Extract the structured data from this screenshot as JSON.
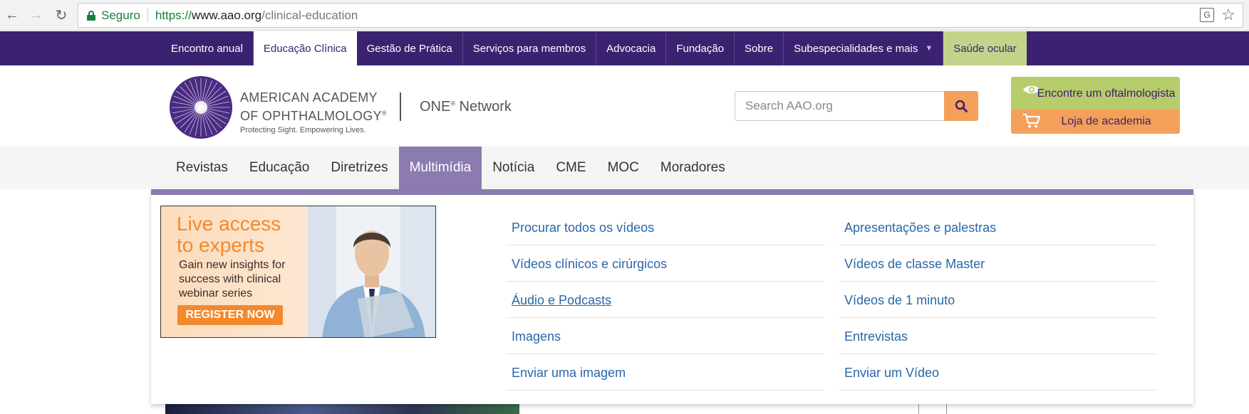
{
  "browser": {
    "secure_label": "Seguro",
    "url_scheme": "https://",
    "url_host": "www.aao.org",
    "url_path": "/clinical-education"
  },
  "top_nav": {
    "items": [
      {
        "label": "Encontro anual"
      },
      {
        "label": "Educação Clínica",
        "active": true
      },
      {
        "label": "Gestão de Prática"
      },
      {
        "label": "Serviços para membros"
      },
      {
        "label": "Advocacia"
      },
      {
        "label": "Fundação"
      },
      {
        "label": "Sobre"
      },
      {
        "label": "Subespecialidades e mais",
        "has_dropdown": true
      },
      {
        "label": "Saúde ocular"
      }
    ]
  },
  "header": {
    "logo_line1": "AMERICAN ACADEMY",
    "logo_line2": "OF OPHTHALMOLOGY",
    "logo_registered": "®",
    "logo_tagline": "Protecting Sight. Empowering Lives.",
    "one_network": "ONE",
    "one_network_reg": "®",
    "one_network_suffix": " Network",
    "search_placeholder": "Search AAO.org",
    "find_ophth_label": "Encontre um oftalmologista",
    "store_label": "Loja de academia"
  },
  "main_nav": {
    "items": [
      {
        "label": "Revistas"
      },
      {
        "label": "Educação"
      },
      {
        "label": "Diretrizes"
      },
      {
        "label": "Multimídia",
        "active": true
      },
      {
        "label": "Notícia"
      },
      {
        "label": "CME"
      },
      {
        "label": "MOC"
      },
      {
        "label": "Moradores"
      }
    ]
  },
  "dropdown": {
    "promo": {
      "heading_line1": "Live access",
      "heading_line2": "to experts",
      "sub_line1": "Gain new insights for",
      "sub_line2": "success with clinical",
      "sub_line3": "webinar series",
      "button": "REGISTER NOW"
    },
    "col1": [
      "Procurar todos os vídeos",
      "Vídeos clínicos e cirúrgicos",
      "Áudio e Podcasts",
      "Imagens",
      "Enviar uma imagem"
    ],
    "col2": [
      "Apresentações e palestras",
      "Vídeos de classe Master",
      "Vídeos de 1 minuto",
      "Entrevistas",
      "Enviar um Vídeo"
    ]
  },
  "colors": {
    "brand_purple": "#3b2270",
    "active_nav": "#8b7bb0",
    "accent_orange": "#f5a05a",
    "accent_green": "#b7cc6a",
    "link_blue": "#2a67a8"
  }
}
